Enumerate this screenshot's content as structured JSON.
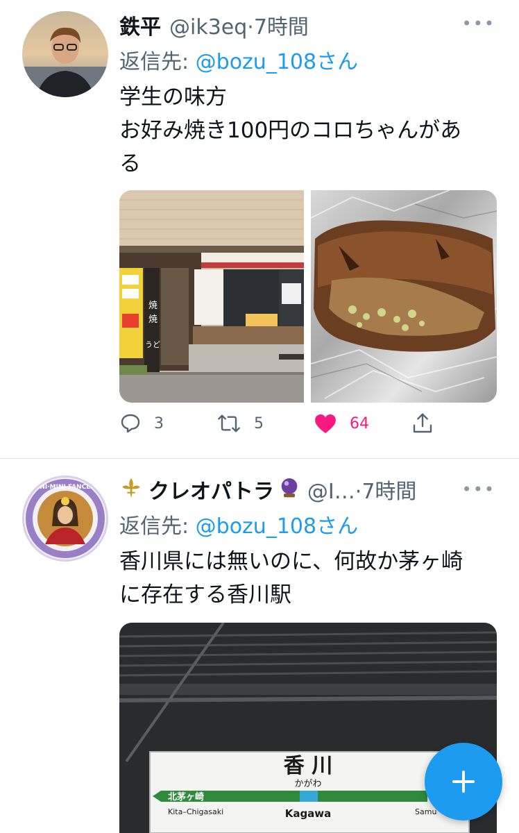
{
  "tweets": [
    {
      "author_name": "鉄平",
      "handle": "@ik3eq",
      "separator": "·",
      "time": "7時間",
      "reply_prefix": "返信先: ",
      "reply_to": "@bozu_108さん",
      "text_lines": [
        "学生の味方",
        "お好み焼き100円のコロちゃんがあ",
        "る"
      ],
      "stats": {
        "replies": "3",
        "retweets": "5",
        "likes": "64"
      }
    },
    {
      "author_name": "クレオパトラ",
      "handle": "@I…",
      "separator": "·",
      "time": "7時間",
      "reply_prefix": "返信先: ",
      "reply_to": "@bozu_108さん",
      "text_lines": [
        "香川県には無いのに、何故か茅ヶ崎",
        "に存在する香川駅"
      ],
      "station_sign": {
        "name": "香 川",
        "kana": "かがわ",
        "prev_station": "北茅ヶ崎",
        "prev_station_romaji": "Kita–Chigasaki",
        "romaji": "Kagawa",
        "next_station_romaji": "Samu"
      }
    }
  ],
  "shop_photo": {
    "sign_chars": [
      "焼",
      "焼",
      "うどん"
    ]
  },
  "avatar2_text": "INI·MINI FANCL!",
  "more_label": "•••",
  "compose_label": "+",
  "colors": {
    "accent": "#1d9bf0",
    "like": "#f91880",
    "secondary_text": "#536471"
  },
  "icons": [
    "reply-icon",
    "retweet-icon",
    "heart-icon",
    "share-icon",
    "fleur-de-lis-icon",
    "crystal-ball-icon",
    "plus-icon",
    "more-icon"
  ]
}
